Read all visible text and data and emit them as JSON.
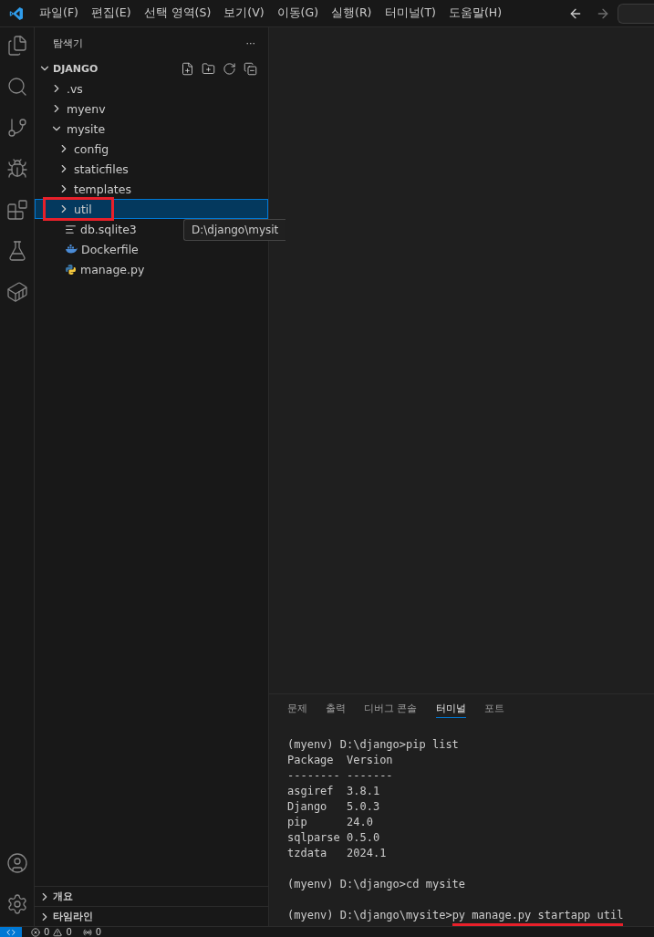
{
  "menu": [
    "파일(F)",
    "편집(E)",
    "선택 영역(S)",
    "보기(V)",
    "이동(G)",
    "실행(R)",
    "터미널(T)",
    "도움말(H)"
  ],
  "sidebar": {
    "title": "탐색기",
    "more": "···",
    "section": {
      "title": "DJANGO",
      "expanded": true
    },
    "tree": [
      {
        "label": ".vs",
        "kind": "folder",
        "expanded": false,
        "selected": false
      },
      {
        "label": "myenv",
        "kind": "folder",
        "expanded": false,
        "selected": false
      },
      {
        "label": "mysite",
        "kind": "folder",
        "expanded": true,
        "selected": false,
        "children": [
          {
            "label": "config",
            "kind": "folder",
            "expanded": false,
            "selected": false
          },
          {
            "label": "staticfiles",
            "kind": "folder",
            "expanded": false,
            "selected": false
          },
          {
            "label": "templates",
            "kind": "folder",
            "expanded": false,
            "selected": false
          },
          {
            "label": "util",
            "kind": "folder",
            "expanded": false,
            "selected": true,
            "highlighted": true
          },
          {
            "label": "db.sqlite3",
            "kind": "text",
            "selected": false
          },
          {
            "label": "Dockerfile",
            "kind": "docker",
            "selected": false
          },
          {
            "label": "manage.py",
            "kind": "python",
            "selected": false
          }
        ]
      }
    ],
    "tooltip": "D:\\django\\mysit",
    "bottom_sections": [
      {
        "title": "개요",
        "expanded": false
      },
      {
        "title": "타임라인",
        "expanded": false
      }
    ]
  },
  "panel": {
    "tabs": [
      {
        "label": "문제",
        "selected": false
      },
      {
        "label": "출력",
        "selected": false
      },
      {
        "label": "디버그 콘솔",
        "selected": false
      },
      {
        "label": "터미널",
        "selected": true
      },
      {
        "label": "포트",
        "selected": false
      }
    ],
    "terminal": [
      {
        "kind": "output",
        "text": "(myenv) D:\\django>pip list"
      },
      {
        "kind": "output",
        "text": "Package  Version"
      },
      {
        "kind": "output",
        "text": "-------- -------"
      },
      {
        "kind": "output",
        "text": "asgiref  3.8.1"
      },
      {
        "kind": "output",
        "text": "Django   5.0.3"
      },
      {
        "kind": "output",
        "text": "pip      24.0"
      },
      {
        "kind": "output",
        "text": "sqlparse 0.5.0"
      },
      {
        "kind": "output",
        "text": "tzdata   2024.1"
      },
      {
        "kind": "blank"
      },
      {
        "kind": "output",
        "text": "(myenv) D:\\django>cd mysite"
      },
      {
        "kind": "blank"
      },
      {
        "kind": "command",
        "prompt": "(myenv) D:\\django\\mysite>",
        "command": "py manage.py startapp util",
        "underlined": true
      }
    ]
  },
  "status_bar": {
    "errors": "0",
    "warnings": "0",
    "ports": "0"
  }
}
